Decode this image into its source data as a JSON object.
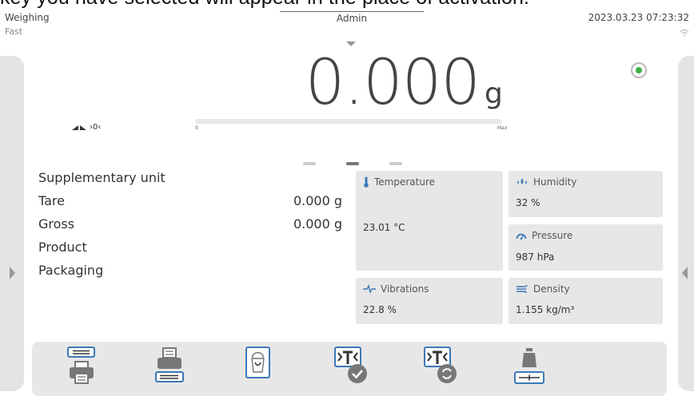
{
  "caption": "key you have selected will appear in the place of activation.",
  "header": {
    "mode": "Weighing",
    "submode": "Fast",
    "user": "Admin",
    "datetime": "2023.03.23 07:23:32"
  },
  "weighing": {
    "value": "0.000",
    "unit": "g",
    "zero_indicator": "›0‹",
    "bar_min": "0",
    "bar_max": "Max",
    "bar_fill": 0
  },
  "info": [
    {
      "label": "Supplementary unit",
      "value": ""
    },
    {
      "label": "Tare",
      "value": "0.000 g"
    },
    {
      "label": "Gross",
      "value": "0.000 g"
    },
    {
      "label": "Product",
      "value": ""
    },
    {
      "label": "Packaging",
      "value": ""
    }
  ],
  "env": {
    "temperature": {
      "label": "Temperature",
      "value": "23.01 °C"
    },
    "humidity": {
      "label": "Humidity",
      "value": "32 %"
    },
    "pressure": {
      "label": "Pressure",
      "value": "987 hPa"
    },
    "vibrations": {
      "label": "Vibrations",
      "value": "22.8 %"
    },
    "density": {
      "label": "Density",
      "value": "1.155 kg/m³"
    }
  },
  "colors": {
    "accent": "#3c78b8",
    "stable": "#3cb043",
    "panel": "#e7e7e7"
  },
  "toolbar": [
    {
      "icon": "print-header-icon"
    },
    {
      "icon": "print-footer-icon"
    },
    {
      "icon": "packaging-icon"
    },
    {
      "icon": "tare-confirm-icon"
    },
    {
      "icon": "tare-reset-icon"
    },
    {
      "icon": "adjustment-icon"
    }
  ]
}
